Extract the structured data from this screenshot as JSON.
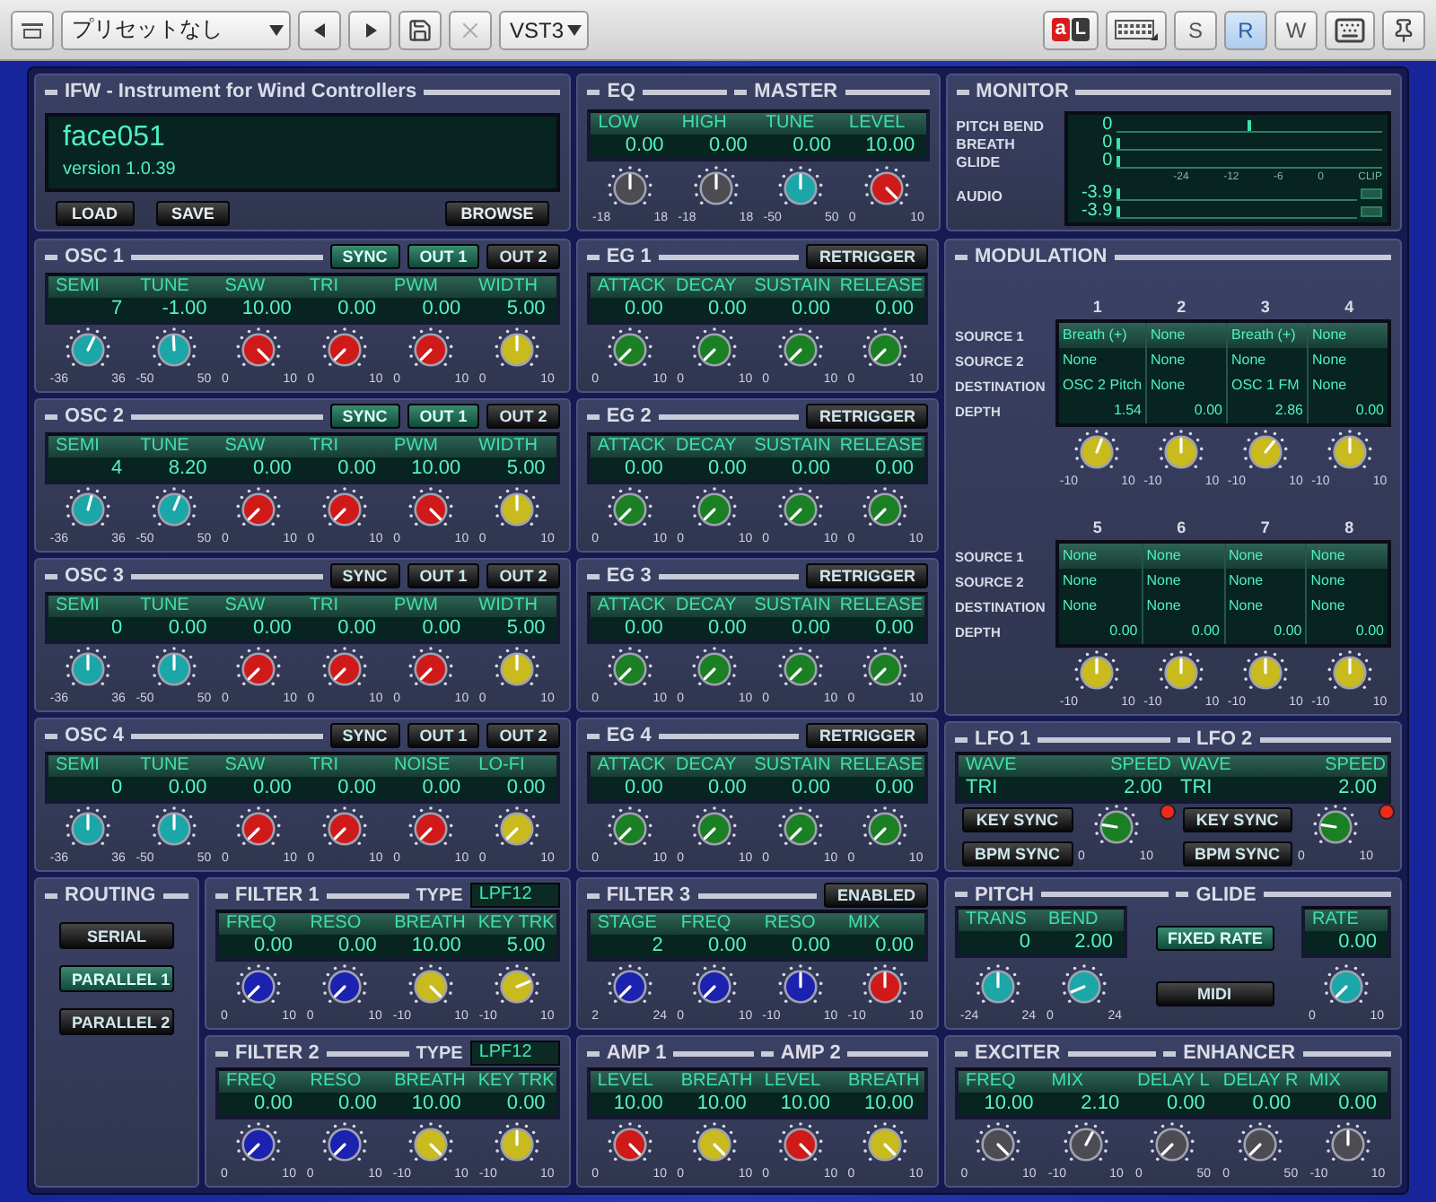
{
  "toolbar": {
    "preset": "プリセットなし",
    "plugin_format": "VST3",
    "link": {
      "left": "a",
      "right": "L"
    },
    "delete_disabled": true,
    "modes": [
      {
        "label": "S",
        "selected": false
      },
      {
        "label": "R",
        "selected": true
      },
      {
        "label": "W",
        "selected": false
      }
    ]
  },
  "instrument": {
    "title": "IFW - Instrument for Wind Controllers",
    "patch_name": "face051",
    "version": "version 1.0.39",
    "buttons": [
      "LOAD",
      "SAVE",
      "BROWSE"
    ]
  },
  "eq_master": {
    "titles": [
      "EQ",
      "MASTER"
    ],
    "params": [
      {
        "label": "LOW",
        "value": "0.00",
        "color": "#4c4c52",
        "min": "-18",
        "max": "18"
      },
      {
        "label": "HIGH",
        "value": "0.00",
        "color": "#4c4c52",
        "min": "-18",
        "max": "18"
      },
      {
        "label": "TUNE",
        "value": "0.00",
        "color": "#1ba6a8",
        "min": "-50",
        "max": "50"
      },
      {
        "label": "LEVEL",
        "value": "10.00",
        "color": "#d01a1a",
        "min": "0",
        "max": "10"
      }
    ]
  },
  "monitor": {
    "title": "MONITOR",
    "rows": [
      {
        "label": "PITCH BEND",
        "meters": [
          {
            "value": "0",
            "level": 0.5,
            "kind": "marker"
          }
        ]
      },
      {
        "label": "BREATH",
        "meters": [
          {
            "value": "0",
            "level": 0,
            "kind": "bar"
          }
        ]
      },
      {
        "label": "GLIDE",
        "meters": [
          {
            "value": "0",
            "level": 0,
            "kind": "bar"
          }
        ]
      },
      {
        "label": "AUDIO",
        "scale": [
          "-24",
          "-12",
          "-6",
          "0",
          "CLIP"
        ],
        "meters": [
          {
            "value": "-3.9",
            "level": 0,
            "kind": "clip_bar"
          },
          {
            "value": "-3.9",
            "level": 0,
            "kind": "clip_bar"
          }
        ]
      }
    ]
  },
  "oscillators": [
    {
      "titles": [
        "OSC 1"
      ],
      "buttons": [
        {
          "label": "SYNC",
          "on": true
        },
        {
          "label": "OUT 1",
          "on": true
        },
        {
          "label": "OUT 2",
          "on": false
        }
      ],
      "params": [
        {
          "label": "SEMI",
          "value": "7",
          "color": "#1ba6a8",
          "min": "-36",
          "max": "36"
        },
        {
          "label": "TUNE",
          "value": "-1.00",
          "color": "#1ba6a8",
          "min": "-50",
          "max": "50"
        },
        {
          "label": "SAW",
          "value": "10.00",
          "color": "#d01a1a",
          "min": "0",
          "max": "10"
        },
        {
          "label": "TRI",
          "value": "0.00",
          "color": "#d01a1a",
          "min": "0",
          "max": "10"
        },
        {
          "label": "PWM",
          "value": "0.00",
          "color": "#d01a1a",
          "min": "0",
          "max": "10"
        },
        {
          "label": "WIDTH",
          "value": "5.00",
          "color": "#c9bb1e",
          "min": "0",
          "max": "10"
        }
      ]
    },
    {
      "titles": [
        "OSC 2"
      ],
      "buttons": [
        {
          "label": "SYNC",
          "on": true
        },
        {
          "label": "OUT 1",
          "on": true
        },
        {
          "label": "OUT 2",
          "on": false
        }
      ],
      "params": [
        {
          "label": "SEMI",
          "value": "4",
          "color": "#1ba6a8",
          "min": "-36",
          "max": "36"
        },
        {
          "label": "TUNE",
          "value": "8.20",
          "color": "#1ba6a8",
          "min": "-50",
          "max": "50"
        },
        {
          "label": "SAW",
          "value": "0.00",
          "color": "#d01a1a",
          "min": "0",
          "max": "10"
        },
        {
          "label": "TRI",
          "value": "0.00",
          "color": "#d01a1a",
          "min": "0",
          "max": "10"
        },
        {
          "label": "PWM",
          "value": "10.00",
          "color": "#d01a1a",
          "min": "0",
          "max": "10"
        },
        {
          "label": "WIDTH",
          "value": "5.00",
          "color": "#c9bb1e",
          "min": "0",
          "max": "10"
        }
      ]
    },
    {
      "titles": [
        "OSC 3"
      ],
      "buttons": [
        {
          "label": "SYNC",
          "on": false
        },
        {
          "label": "OUT 1",
          "on": false
        },
        {
          "label": "OUT 2",
          "on": false
        }
      ],
      "params": [
        {
          "label": "SEMI",
          "value": "0",
          "color": "#1ba6a8",
          "min": "-36",
          "max": "36"
        },
        {
          "label": "TUNE",
          "value": "0.00",
          "color": "#1ba6a8",
          "min": "-50",
          "max": "50"
        },
        {
          "label": "SAW",
          "value": "0.00",
          "color": "#d01a1a",
          "min": "0",
          "max": "10"
        },
        {
          "label": "TRI",
          "value": "0.00",
          "color": "#d01a1a",
          "min": "0",
          "max": "10"
        },
        {
          "label": "PWM",
          "value": "0.00",
          "color": "#d01a1a",
          "min": "0",
          "max": "10"
        },
        {
          "label": "WIDTH",
          "value": "5.00",
          "color": "#c9bb1e",
          "min": "0",
          "max": "10"
        }
      ]
    },
    {
      "titles": [
        "OSC 4"
      ],
      "buttons": [
        {
          "label": "SYNC",
          "on": false
        },
        {
          "label": "OUT 1",
          "on": false
        },
        {
          "label": "OUT 2",
          "on": false
        }
      ],
      "params": [
        {
          "label": "SEMI",
          "value": "0",
          "color": "#1ba6a8",
          "min": "-36",
          "max": "36"
        },
        {
          "label": "TUNE",
          "value": "0.00",
          "color": "#1ba6a8",
          "min": "-50",
          "max": "50"
        },
        {
          "label": "SAW",
          "value": "0.00",
          "color": "#d01a1a",
          "min": "0",
          "max": "10"
        },
        {
          "label": "TRI",
          "value": "0.00",
          "color": "#d01a1a",
          "min": "0",
          "max": "10"
        },
        {
          "label": "NOISE",
          "value": "0.00",
          "color": "#d01a1a",
          "min": "0",
          "max": "10"
        },
        {
          "label": "LO-FI",
          "value": "0.00",
          "color": "#c9bb1e",
          "min": "0",
          "max": "10"
        }
      ]
    }
  ],
  "envelopes": [
    {
      "titles": [
        "EG 1"
      ],
      "buttons": [
        {
          "label": "RETRIGGER",
          "on": false
        }
      ],
      "params": [
        {
          "label": "ATTACK",
          "value": "0.00",
          "color": "#1b7f24",
          "min": "0",
          "max": "10"
        },
        {
          "label": "DECAY",
          "value": "0.00",
          "color": "#1b7f24",
          "min": "0",
          "max": "10"
        },
        {
          "label": "SUSTAIN",
          "value": "0.00",
          "color": "#1b7f24",
          "min": "0",
          "max": "10"
        },
        {
          "label": "RELEASE",
          "value": "0.00",
          "color": "#1b7f24",
          "min": "0",
          "max": "10"
        }
      ]
    },
    {
      "titles": [
        "EG 2"
      ],
      "buttons": [
        {
          "label": "RETRIGGER",
          "on": false
        }
      ],
      "params": [
        {
          "label": "ATTACK",
          "value": "0.00",
          "color": "#1b7f24",
          "min": "0",
          "max": "10"
        },
        {
          "label": "DECAY",
          "value": "0.00",
          "color": "#1b7f24",
          "min": "0",
          "max": "10"
        },
        {
          "label": "SUSTAIN",
          "value": "0.00",
          "color": "#1b7f24",
          "min": "0",
          "max": "10"
        },
        {
          "label": "RELEASE",
          "value": "0.00",
          "color": "#1b7f24",
          "min": "0",
          "max": "10"
        }
      ]
    },
    {
      "titles": [
        "EG 3"
      ],
      "buttons": [
        {
          "label": "RETRIGGER",
          "on": false
        }
      ],
      "params": [
        {
          "label": "ATTACK",
          "value": "0.00",
          "color": "#1b7f24",
          "min": "0",
          "max": "10"
        },
        {
          "label": "DECAY",
          "value": "0.00",
          "color": "#1b7f24",
          "min": "0",
          "max": "10"
        },
        {
          "label": "SUSTAIN",
          "value": "0.00",
          "color": "#1b7f24",
          "min": "0",
          "max": "10"
        },
        {
          "label": "RELEASE",
          "value": "0.00",
          "color": "#1b7f24",
          "min": "0",
          "max": "10"
        }
      ]
    },
    {
      "titles": [
        "EG 4"
      ],
      "buttons": [
        {
          "label": "RETRIGGER",
          "on": false
        }
      ],
      "params": [
        {
          "label": "ATTACK",
          "value": "0.00",
          "color": "#1b7f24",
          "min": "0",
          "max": "10"
        },
        {
          "label": "DECAY",
          "value": "0.00",
          "color": "#1b7f24",
          "min": "0",
          "max": "10"
        },
        {
          "label": "SUSTAIN",
          "value": "0.00",
          "color": "#1b7f24",
          "min": "0",
          "max": "10"
        },
        {
          "label": "RELEASE",
          "value": "0.00",
          "color": "#1b7f24",
          "min": "0",
          "max": "10"
        }
      ]
    }
  ],
  "modulation": {
    "title": "MODULATION",
    "banks": [
      {
        "row_labels": [
          "SOURCE 1",
          "SOURCE 2",
          "DESTINATION",
          "DEPTH"
        ],
        "slots": [
          {
            "number": "1",
            "source_1": "Breath (+)",
            "source_2": "None",
            "destination": "OSC 2 Pitch",
            "depth": "1.54",
            "color": "#c9bb1e",
            "min": "-10",
            "max": "10"
          },
          {
            "number": "2",
            "source_1": "None",
            "source_2": "None",
            "destination": "None",
            "depth": "0.00",
            "color": "#c9bb1e",
            "min": "-10",
            "max": "10"
          },
          {
            "number": "3",
            "source_1": "Breath (+)",
            "source_2": "None",
            "destination": "OSC 1 FM",
            "depth": "2.86",
            "color": "#c9bb1e",
            "min": "-10",
            "max": "10"
          },
          {
            "number": "4",
            "source_1": "None",
            "source_2": "None",
            "destination": "None",
            "depth": "0.00",
            "color": "#c9bb1e",
            "min": "-10",
            "max": "10"
          }
        ]
      },
      {
        "row_labels": [
          "SOURCE 1",
          "SOURCE 2",
          "DESTINATION",
          "DEPTH"
        ],
        "slots": [
          {
            "number": "5",
            "source_1": "None",
            "source_2": "None",
            "destination": "None",
            "depth": "0.00",
            "color": "#c9bb1e",
            "min": "-10",
            "max": "10"
          },
          {
            "number": "6",
            "source_1": "None",
            "source_2": "None",
            "destination": "None",
            "depth": "0.00",
            "color": "#c9bb1e",
            "min": "-10",
            "max": "10"
          },
          {
            "number": "7",
            "source_1": "None",
            "source_2": "None",
            "destination": "None",
            "depth": "0.00",
            "color": "#c9bb1e",
            "min": "-10",
            "max": "10"
          },
          {
            "number": "8",
            "source_1": "None",
            "source_2": "None",
            "destination": "None",
            "depth": "0.00",
            "color": "#c9bb1e",
            "min": "-10",
            "max": "10"
          }
        ]
      }
    ]
  },
  "routing": {
    "title": "ROUTING",
    "options": [
      {
        "label": "SERIAL",
        "selected": false
      },
      {
        "label": "PARALLEL 1",
        "selected": true
      },
      {
        "label": "PARALLEL 2",
        "selected": false
      }
    ]
  },
  "filters": [
    {
      "titles": [
        "FILTER 1"
      ],
      "type_label": "TYPE",
      "type": "LPF12",
      "params": [
        {
          "label": "FREQ",
          "value": "0.00",
          "color": "#1c22b0",
          "min": "0",
          "max": "10"
        },
        {
          "label": "RESO",
          "value": "0.00",
          "color": "#1c22b0",
          "min": "0",
          "max": "10"
        },
        {
          "label": "BREATH",
          "value": "10.00",
          "color": "#c9bb1e",
          "min": "-10",
          "max": "10"
        },
        {
          "label": "KEY TRK",
          "value": "5.00",
          "color": "#c9bb1e",
          "min": "-10",
          "max": "10"
        }
      ]
    },
    {
      "titles": [
        "FILTER 2"
      ],
      "type_label": "TYPE",
      "type": "LPF12",
      "params": [
        {
          "label": "FREQ",
          "value": "0.00",
          "color": "#1c22b0",
          "min": "0",
          "max": "10"
        },
        {
          "label": "RESO",
          "value": "0.00",
          "color": "#1c22b0",
          "min": "0",
          "max": "10"
        },
        {
          "label": "BREATH",
          "value": "10.00",
          "color": "#c9bb1e",
          "min": "-10",
          "max": "10"
        },
        {
          "label": "KEY TRK",
          "value": "0.00",
          "color": "#c9bb1e",
          "min": "-10",
          "max": "10"
        }
      ]
    }
  ],
  "filter_3": {
    "titles": [
      "FILTER 3"
    ],
    "buttons": [
      {
        "label": "ENABLED",
        "on": false
      }
    ],
    "params": [
      {
        "label": "STAGE",
        "value": "2",
        "color": "#1c22b0",
        "min": "2",
        "max": "24"
      },
      {
        "label": "FREQ",
        "value": "0.00",
        "color": "#1c22b0",
        "min": "0",
        "max": "10"
      },
      {
        "label": "RESO",
        "value": "0.00",
        "color": "#1c22b0",
        "min": "-10",
        "max": "10"
      },
      {
        "label": "MIX",
        "value": "0.00",
        "color": "#d01a1a",
        "min": "-10",
        "max": "10"
      }
    ]
  },
  "amps": {
    "titles": [
      "AMP 1",
      "AMP 2"
    ],
    "params": [
      {
        "label": "LEVEL",
        "value": "10.00",
        "color": "#d01a1a",
        "min": "0",
        "max": "10"
      },
      {
        "label": "BREATH",
        "value": "10.00",
        "color": "#c9bb1e",
        "min": "0",
        "max": "10"
      },
      {
        "label": "LEVEL",
        "value": "10.00",
        "color": "#d01a1a",
        "min": "0",
        "max": "10"
      },
      {
        "label": "BREATH",
        "value": "10.00",
        "color": "#c9bb1e",
        "min": "0",
        "max": "10"
      }
    ]
  },
  "lfos": {
    "titles": [
      "LFO 1",
      "LFO 2"
    ],
    "units": [
      {
        "wave_label": "WAVE",
        "speed_label": "SPEED",
        "wave": "TRI",
        "speed": "2.00",
        "buttons": [
          {
            "label": "KEY SYNC",
            "on": false
          },
          {
            "label": "BPM SYNC",
            "on": false
          }
        ],
        "knob": {
          "color": "#1b7f24",
          "min": "0",
          "max": "10"
        },
        "led_on": true
      },
      {
        "wave_label": "WAVE",
        "speed_label": "SPEED",
        "wave": "TRI",
        "speed": "2.00",
        "buttons": [
          {
            "label": "KEY SYNC",
            "on": false
          },
          {
            "label": "BPM SYNC",
            "on": false
          }
        ],
        "knob": {
          "color": "#1b7f24",
          "min": "0",
          "max": "10"
        },
        "led_on": true
      }
    ]
  },
  "pitch_glide": {
    "titles": [
      "PITCH",
      "GLIDE"
    ],
    "pitch_params": [
      {
        "label": "TRANS",
        "value": "0",
        "color": "#1ba6a8",
        "min": "-24",
        "max": "24"
      },
      {
        "label": "BEND",
        "value": "2.00",
        "color": "#1ba6a8",
        "min": "0",
        "max": "24"
      }
    ],
    "glide_buttons": [
      {
        "label": "FIXED RATE",
        "on": true
      },
      {
        "label": "MIDI",
        "on": false
      }
    ],
    "glide_params": [
      {
        "label": "RATE",
        "value": "0.00",
        "color": "#1ba6a8",
        "min": "0",
        "max": "10"
      }
    ]
  },
  "exciter_enhancer": {
    "titles": [
      "EXCITER",
      "ENHANCER"
    ],
    "params": [
      {
        "label": "FREQ",
        "value": "10.00",
        "color": "#4c4c52",
        "min": "0",
        "max": "10"
      },
      {
        "label": "MIX",
        "value": "2.10",
        "color": "#4c4c52",
        "min": "-10",
        "max": "10"
      },
      {
        "label": "DELAY L",
        "value": "0.00",
        "color": "#4c4c52",
        "min": "0",
        "max": "50"
      },
      {
        "label": "DELAY R",
        "value": "0.00",
        "color": "#4c4c52",
        "min": "0",
        "max": "50"
      },
      {
        "label": "MIX",
        "value": "0.00",
        "color": "#4c4c52",
        "min": "-10",
        "max": "10"
      }
    ]
  }
}
